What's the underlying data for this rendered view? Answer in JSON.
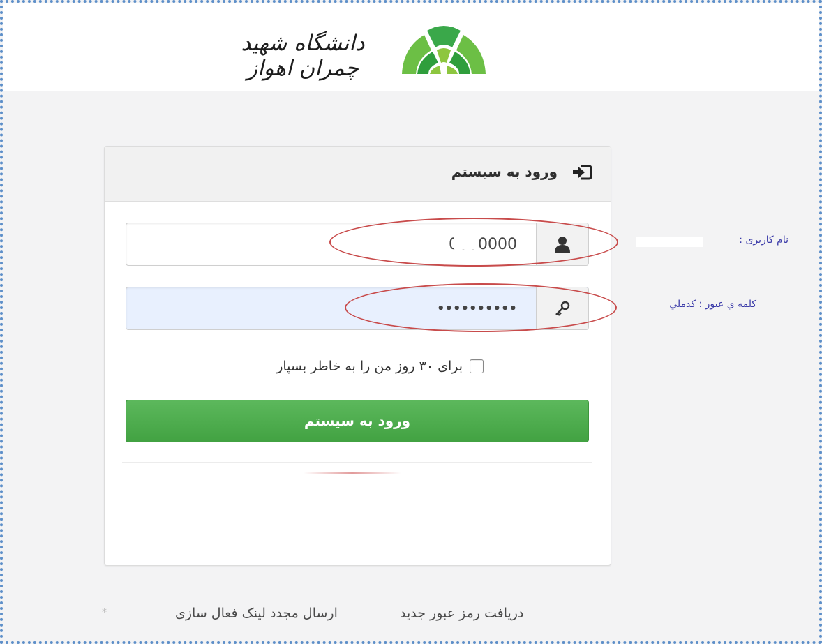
{
  "header": {
    "university_name": "دانشگاه شهید چمران اهواز",
    "logo_colors": [
      "#2f9e3c",
      "#8dc63f"
    ]
  },
  "login_panel": {
    "title": "ورود به سیستم",
    "title_icon": "sign-in-icon",
    "username": {
      "value": "0000000",
      "icon": "user-icon"
    },
    "password": {
      "value": "••••••••••",
      "icon": "key-icon"
    },
    "remember_me_label": "برای ۳۰ روز من را به خاطر بسپار",
    "remember_me_checked": false,
    "submit_label": "ورود به سیستم",
    "submit_color": "#4cae4c"
  },
  "annotations": {
    "username_hint": "نام کاربری :",
    "password_hint": "کلمه ي عبور : كدملي",
    "circle_color": "#c84b4b"
  },
  "footer": {
    "forgot_password": "دریافت رمز عبور جدید",
    "resend_activation": "ارسال مجدد لینک فعال سازی",
    "bullet": "*"
  }
}
